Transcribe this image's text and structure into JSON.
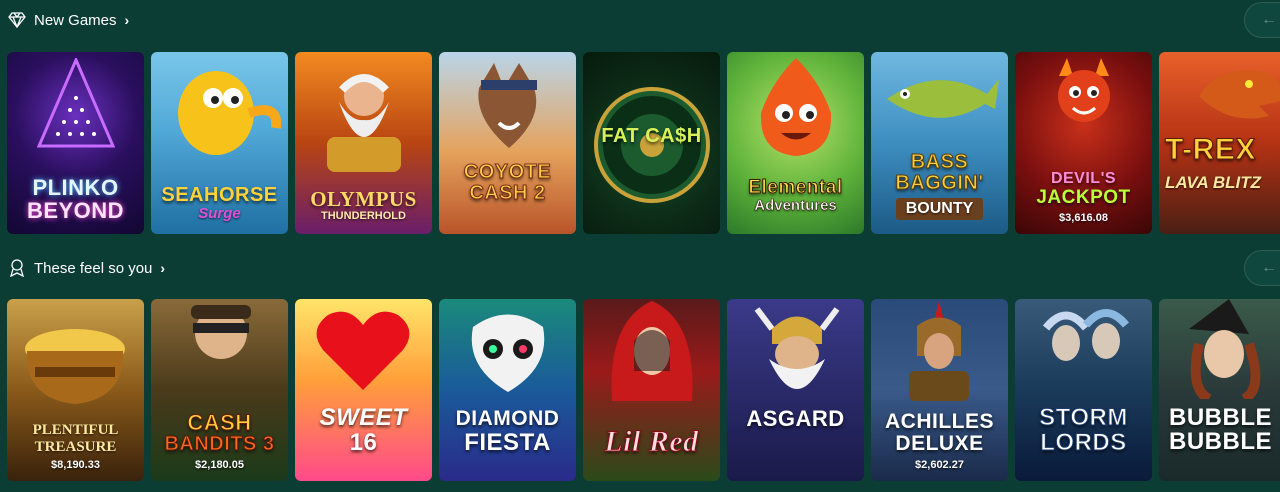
{
  "sections": [
    {
      "title": "New Games",
      "icon": "diamond-icon",
      "tiles": [
        {
          "l1": "PLINKO",
          "l2": "BEYOND",
          "jackpot": null
        },
        {
          "l1": "SEAHORSE",
          "l2": "Surge",
          "jackpot": null
        },
        {
          "l1": "OLYMPUS",
          "l2": "THUNDERHOLD",
          "jackpot": null
        },
        {
          "l1": "COYOTE",
          "l2": "CASH 2",
          "jackpot": null
        },
        {
          "l1": "FAT CA$H",
          "l2": "",
          "jackpot": null
        },
        {
          "l1": "Elemental",
          "l2": "Adventures",
          "jackpot": null
        },
        {
          "l1": "BASS BAGGIN'",
          "l2": "BOUNTY",
          "jackpot": null
        },
        {
          "l1": "DEVIL'S",
          "l2": "JACKPOT",
          "jackpot": "$3,616.08"
        },
        {
          "l1": "T-REX",
          "l2": "LAVA BLITZ",
          "jackpot": null
        }
      ]
    },
    {
      "title": "These feel so you",
      "icon": "person-medal-icon",
      "tiles": [
        {
          "l1": "PLENTIFUL",
          "l2": "TREASURE",
          "jackpot": "$8,190.33"
        },
        {
          "l1": "CASH",
          "l2": "BANDITS 3",
          "jackpot": "$2,180.05"
        },
        {
          "l1": "SWEET",
          "l2": "16",
          "jackpot": null
        },
        {
          "l1": "DIAMOND",
          "l2": "FIESTA",
          "jackpot": null
        },
        {
          "l1": "Lil Red",
          "l2": "",
          "jackpot": null
        },
        {
          "l1": "ASGARD",
          "l2": "",
          "jackpot": null
        },
        {
          "l1": "ACHILLES",
          "l2": "DELUXE",
          "jackpot": "$2,602.27"
        },
        {
          "l1": "STORM",
          "l2": "LORDS",
          "jackpot": null
        },
        {
          "l1": "BUBBLE",
          "l2": "BUBBLE",
          "jackpot": null
        }
      ]
    }
  ],
  "nav": {
    "prev_label": "←"
  },
  "colors": {
    "background": "#0b3d35"
  }
}
